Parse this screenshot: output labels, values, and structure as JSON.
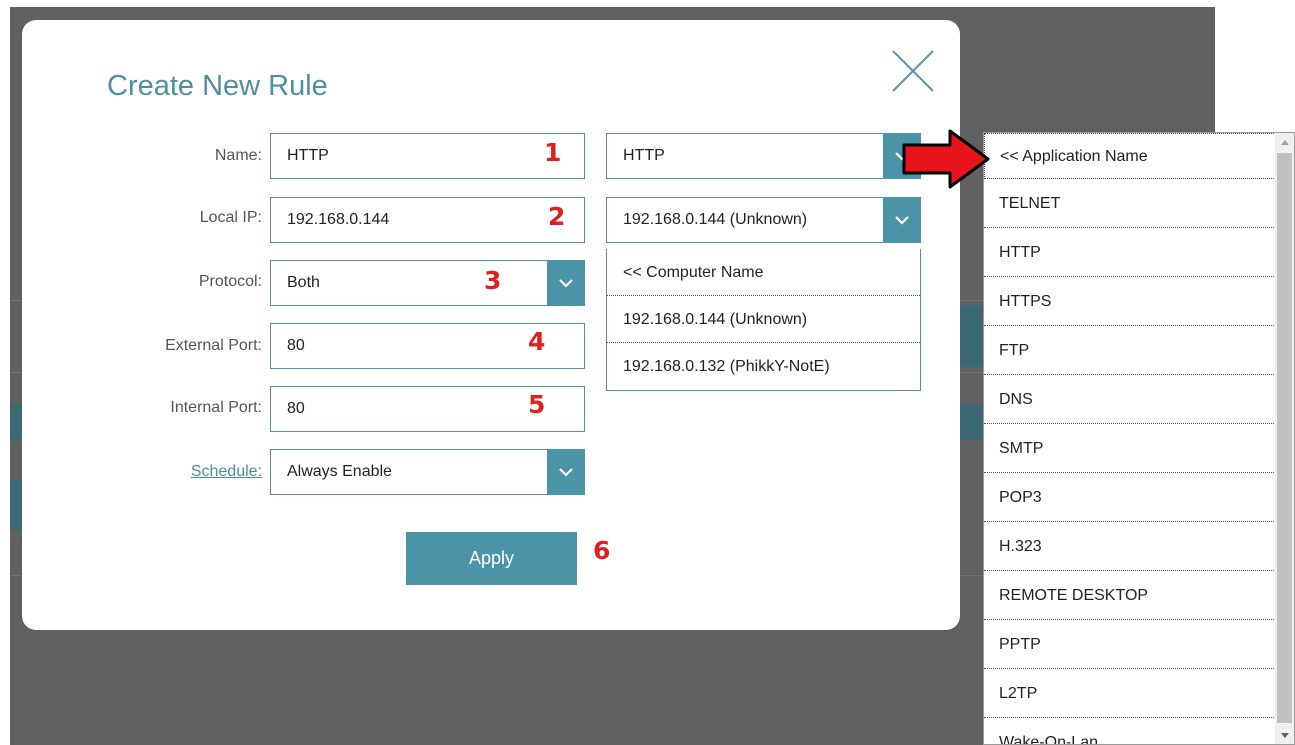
{
  "modal": {
    "title": "Create New Rule",
    "fields": {
      "name": {
        "label": "Name:",
        "value": "HTTP"
      },
      "local_ip": {
        "label": "Local IP:",
        "value": "192.168.0.144"
      },
      "protocol": {
        "label": "Protocol:",
        "value": "Both"
      },
      "external_port": {
        "label": "External Port:",
        "value": "80"
      },
      "internal_port": {
        "label": "Internal Port:",
        "value": "80"
      },
      "schedule": {
        "label": "Schedule:",
        "value": "Always Enable"
      }
    },
    "application_select": {
      "value": "HTTP"
    },
    "computer_select": {
      "value": "192.168.0.144 (Unknown)",
      "options": [
        "<< Computer Name",
        "192.168.0.144 (Unknown)",
        "192.168.0.132 (PhikkY-NotE)"
      ]
    },
    "apply_label": "Apply"
  },
  "annotations": [
    "1",
    "2",
    "3",
    "4",
    "5",
    "6"
  ],
  "annotation_color": "#e02020",
  "application_list": {
    "options": [
      "<< Application Name",
      "TELNET",
      "HTTP",
      "HTTPS",
      "FTP",
      "DNS",
      "SMTP",
      "POP3",
      "H.323",
      "REMOTE DESKTOP",
      "PPTP",
      "L2TP",
      "Wake-On-Lan"
    ]
  },
  "colors": {
    "accent": "#4b94a8",
    "title": "#4f8fa0",
    "overlay": "#606060",
    "arrow": "#e8141c"
  },
  "icons": {
    "close": "close-icon",
    "caret": "chevron-down-icon",
    "pointer": "red-arrow-icon"
  }
}
